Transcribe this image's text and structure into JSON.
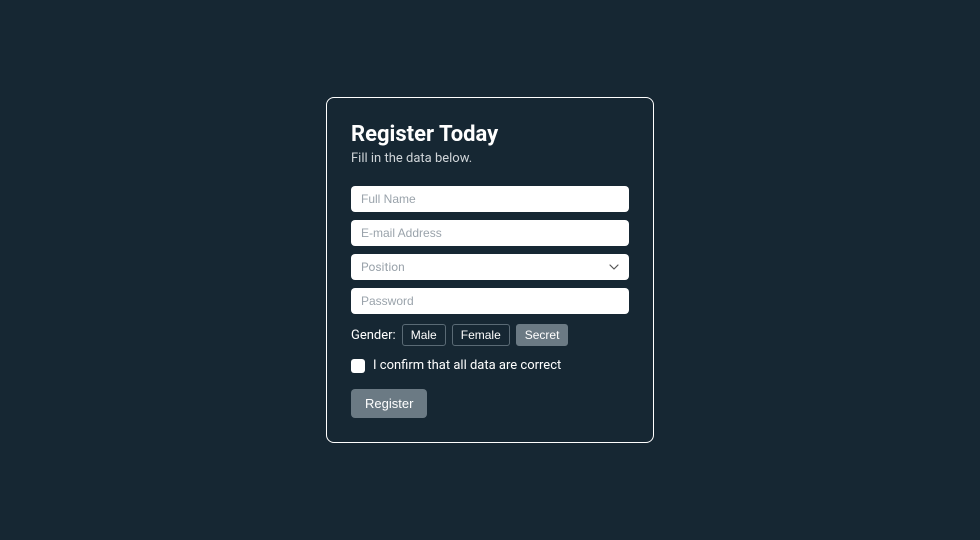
{
  "form": {
    "title": "Register Today",
    "subtitle": "Fill in the data below.",
    "fields": {
      "fullname_placeholder": "Full Name",
      "email_placeholder": "E-mail Address",
      "position_placeholder": "Position",
      "password_placeholder": "Password"
    },
    "gender": {
      "label": "Gender:",
      "options": {
        "male": "Male",
        "female": "Female",
        "secret": "Secret"
      },
      "selected": "secret"
    },
    "confirm_label": "I confirm that all data are correct",
    "submit_label": "Register"
  },
  "colors": {
    "background": "#162733",
    "card_border": "#ffffff",
    "text": "#ffffff",
    "muted_text": "#d0d5d9",
    "field_bg": "#ffffff",
    "placeholder": "#9aa3ab",
    "button_bg": "#6b7a84",
    "gender_border": "#5a6a75"
  }
}
